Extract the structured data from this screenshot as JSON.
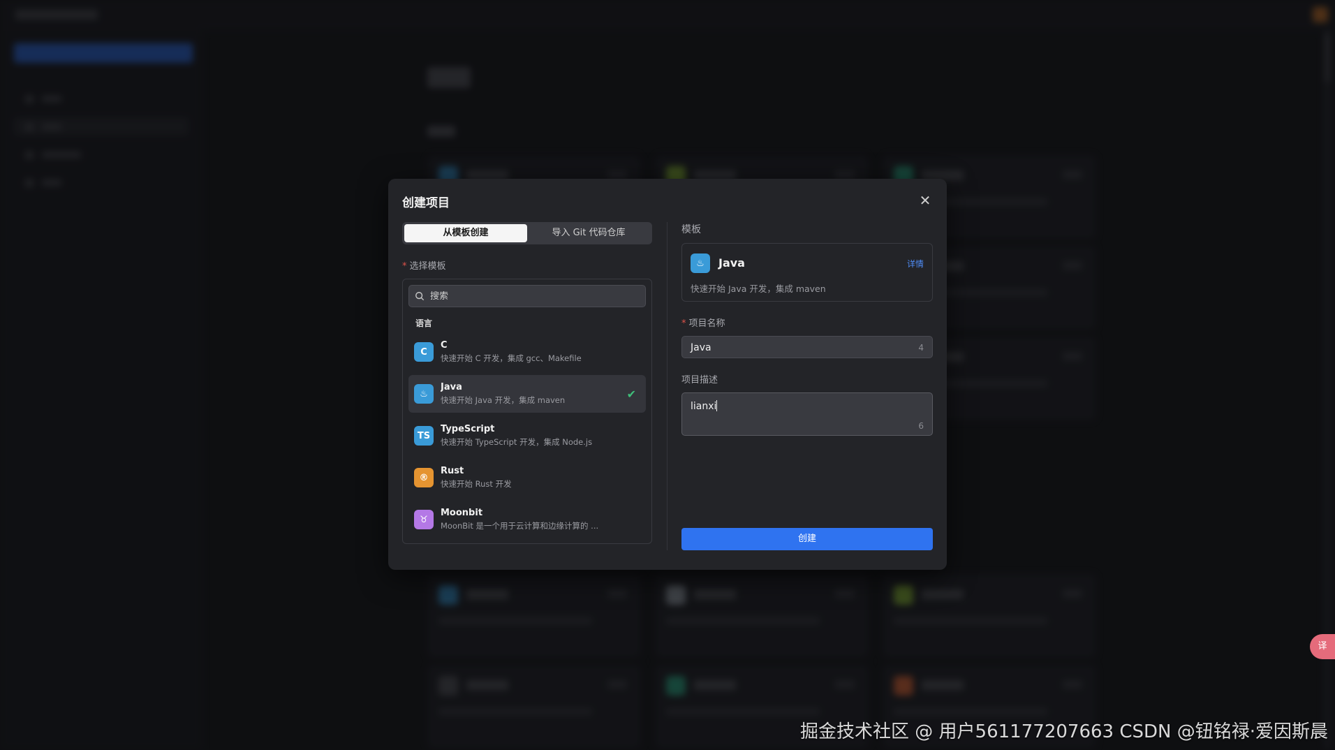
{
  "modal": {
    "title": "创建项目",
    "tabs": [
      {
        "label": "从模板创建",
        "active": true
      },
      {
        "label": "导入 Git 代码仓库",
        "active": false
      }
    ],
    "select_template_label": "选择模板",
    "search_placeholder": "搜索",
    "group_label": "语言",
    "templates": [
      {
        "name": "C",
        "desc": "快速开始 C 开发，集成 gcc、Makefile",
        "icon": "c-logo-icon",
        "glyph": "C",
        "color": "#3a9bd8",
        "selected": false
      },
      {
        "name": "Java",
        "desc": "快速开始 Java 开发，集成 maven",
        "icon": "java-logo-icon",
        "glyph": "♨",
        "color": "#3a9bd8",
        "selected": true
      },
      {
        "name": "TypeScript",
        "desc": "快速开始 TypeScript 开发，集成 Node.js",
        "icon": "typescript-logo-icon",
        "glyph": "TS",
        "color": "#3a9bd8",
        "selected": false
      },
      {
        "name": "Rust",
        "desc": "快速开始 Rust 开发",
        "icon": "rust-logo-icon",
        "glyph": "®",
        "color": "#e59431",
        "selected": false
      },
      {
        "name": "Moonbit",
        "desc": "MoonBit 是一个用于云计算和边缘计算的 ...",
        "icon": "moonbit-logo-icon",
        "glyph": "♉",
        "color": "#b478e6",
        "selected": false
      }
    ],
    "right": {
      "template_section": "模板",
      "selected_template": {
        "name": "Java",
        "desc": "快速开始 Java 开发，集成 maven",
        "details_link": "详情"
      },
      "project_name_label": "项目名称",
      "project_name_value": "Java",
      "project_name_count": "4",
      "project_desc_label": "项目描述",
      "project_desc_value": "lianxi",
      "project_desc_count": "6",
      "create_button": "创建"
    }
  },
  "watermark": "掘金技术社区 @ 用户561177207663 CSDN @钮铭禄·爱因斯晨",
  "float_button": "译",
  "colors": {
    "accent": "#2f73f0",
    "link": "#4f8cf5",
    "check": "#3fbf7a",
    "required": "#e0534a"
  }
}
